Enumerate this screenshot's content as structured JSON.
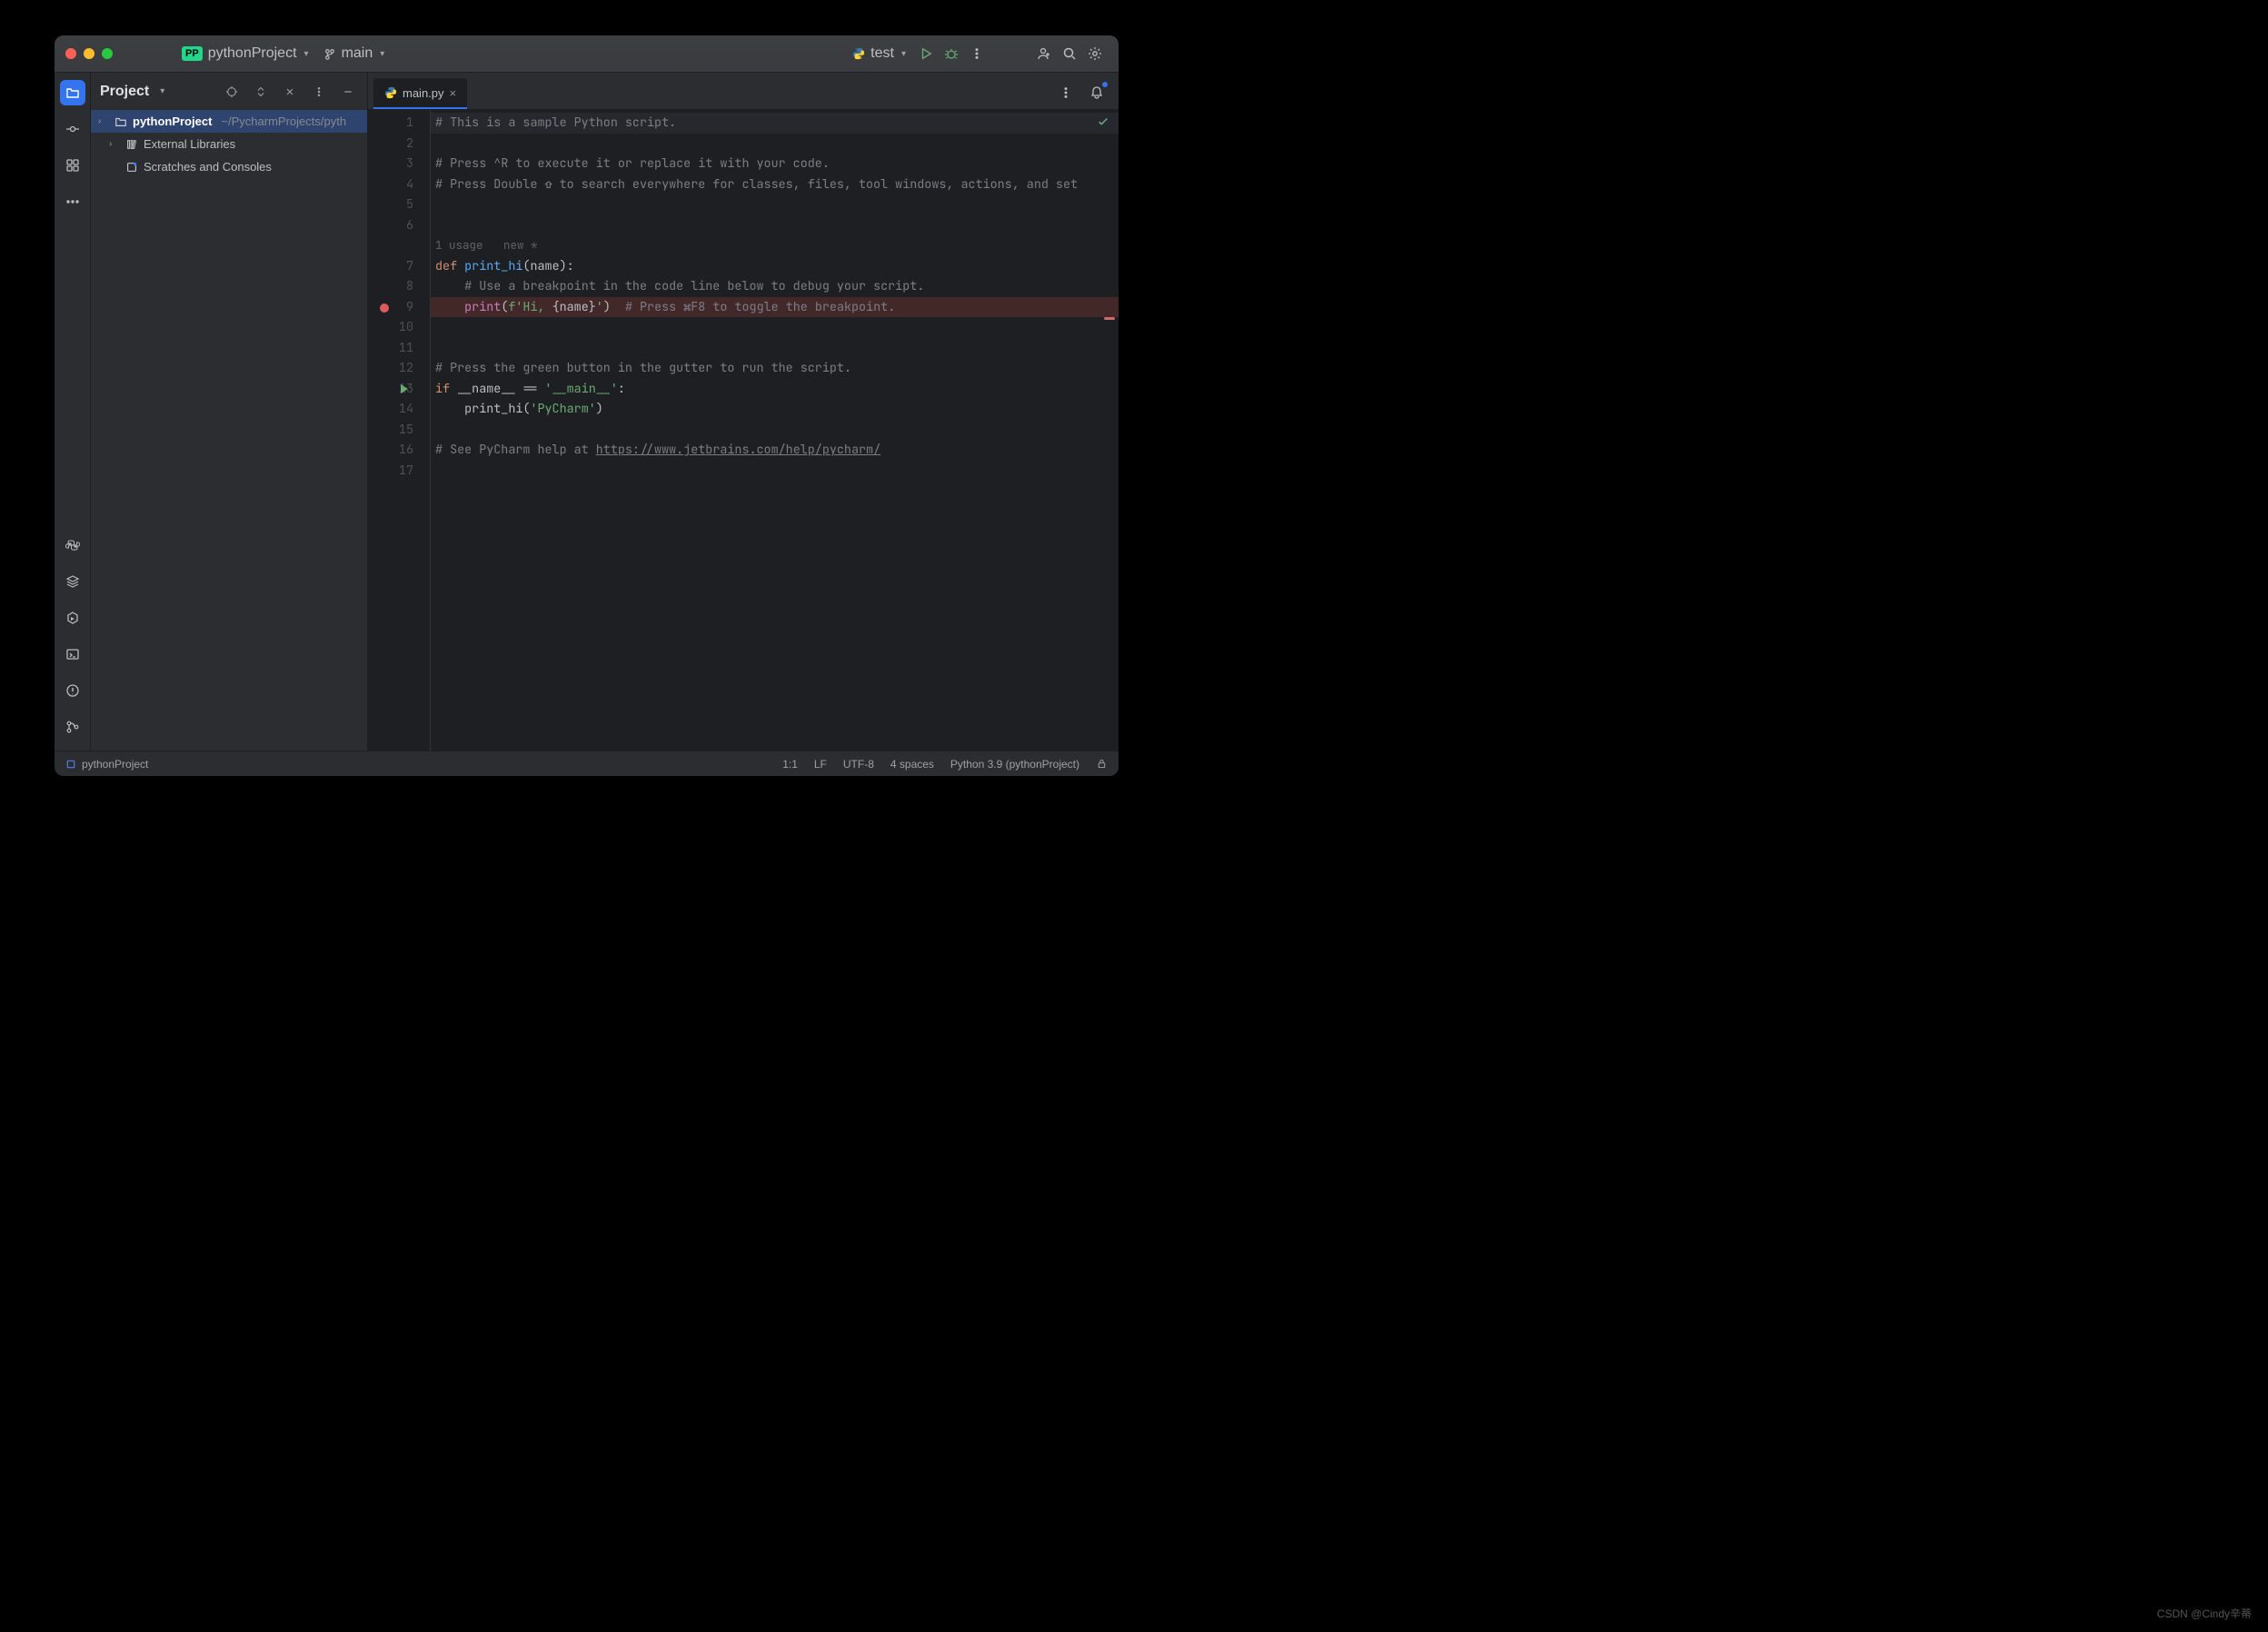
{
  "titlebar": {
    "badge": "PP",
    "project_name": "pythonProject",
    "branch": "main",
    "run_config": "test"
  },
  "sidebar": {
    "title": "Project",
    "tree": {
      "root_name": "pythonProject",
      "root_path": "~/PycharmProjects/pyth",
      "ext_libs": "External Libraries",
      "scratches": "Scratches and Consoles"
    }
  },
  "tabs": {
    "file": "main.py"
  },
  "editor": {
    "inlay": "1 usage   new *",
    "lines": [
      {
        "n": 1,
        "cls": "hl",
        "html": "<span class='c-com'># This is a sample Python script.</span>"
      },
      {
        "n": 2,
        "html": ""
      },
      {
        "n": 3,
        "html": "<span class='c-com'># Press ^R to execute it or replace it with your code.</span>"
      },
      {
        "n": 4,
        "html": "<span class='c-com'># Press Double ⇧ to search everywhere for classes, files, tool windows, actions, and set</span>"
      },
      {
        "n": 5,
        "html": ""
      },
      {
        "n": 6,
        "html": ""
      },
      {
        "n": 7,
        "html": "<span class='c-kw'>def </span><span class='c-fn'>print_hi</span>(<span class='c-param'>name</span>):"
      },
      {
        "n": 8,
        "html": "    <span class='c-com'># Use a breakpoint in the code line below to debug your script.</span>"
      },
      {
        "n": 9,
        "cls": "bp-line",
        "html": "    <span class='c-builtin'>print</span>(<span class='c-str'>f'Hi, </span>{name}<span class='c-str'>'</span>)  <span class='c-com'># Press ⌘F8 to toggle the breakpoint.</span>"
      },
      {
        "n": 10,
        "html": ""
      },
      {
        "n": 11,
        "html": ""
      },
      {
        "n": 12,
        "html": "<span class='c-com'># Press the green button in the gutter to run the script.</span>"
      },
      {
        "n": 13,
        "html": "<span class='c-kw'>if</span> __name__ == <span class='c-str'>'__main__'</span>:"
      },
      {
        "n": 14,
        "html": "    print_hi(<span class='c-str'>'PyCharm'</span>)"
      },
      {
        "n": 15,
        "html": ""
      },
      {
        "n": 16,
        "html": "<span class='c-com'># See PyCharm help at </span><span class='c-link'>https://www.jetbrains.com/help/pycharm/</span>"
      },
      {
        "n": 17,
        "html": ""
      }
    ]
  },
  "status": {
    "project": "pythonProject",
    "pos": "1:1",
    "eol": "LF",
    "encoding": "UTF-8",
    "indent": "4 spaces",
    "interpreter": "Python 3.9 (pythonProject)"
  },
  "watermark": "CSDN @Cindy辛蒂"
}
